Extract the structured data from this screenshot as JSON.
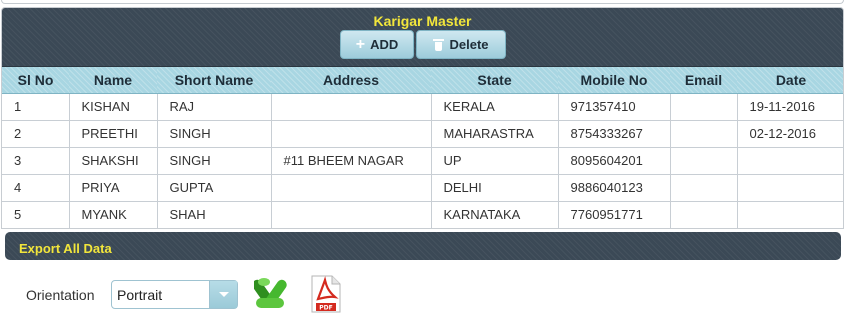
{
  "panel": {
    "title": "Karigar Master",
    "buttons": {
      "add_label": "ADD",
      "delete_label": "Delete"
    }
  },
  "table": {
    "columns": [
      "Sl No",
      "Name",
      "Short Name",
      "Address",
      "State",
      "Mobile No",
      "Email",
      "Date"
    ],
    "rows": [
      [
        "1",
        "KISHAN",
        "RAJ",
        "",
        "KERALA",
        "971357410",
        "",
        "19-11-2016"
      ],
      [
        "2",
        "PREETHI",
        "SINGH",
        "",
        "MAHARASTRA",
        "8754333267",
        "",
        "02-12-2016"
      ],
      [
        "3",
        "SHAKSHI",
        "SINGH",
        "#11 BHEEM NAGAR",
        "UP",
        "8095604201",
        "",
        ""
      ],
      [
        "4",
        "PRIYA",
        "GUPTA",
        "",
        "DELHI",
        "9886040123",
        "",
        ""
      ],
      [
        "5",
        "MYANK",
        "SHAH",
        "",
        "KARNATAKA",
        "7760951771",
        "",
        ""
      ]
    ]
  },
  "export": {
    "title": "Export All Data",
    "orientation_label": "Orientation",
    "orientation_value": "Portrait",
    "pdf_badge": "PDF",
    "icons": [
      "excel-icon",
      "pdf-icon"
    ]
  },
  "colors": {
    "header_bg": "#3b4956",
    "title_yellow": "#f2e63b",
    "column_header_bg": "#a8d6e2",
    "button_bg": "#9dccdb",
    "excel_green": "#3fae29",
    "pdf_red": "#d42a1f"
  }
}
